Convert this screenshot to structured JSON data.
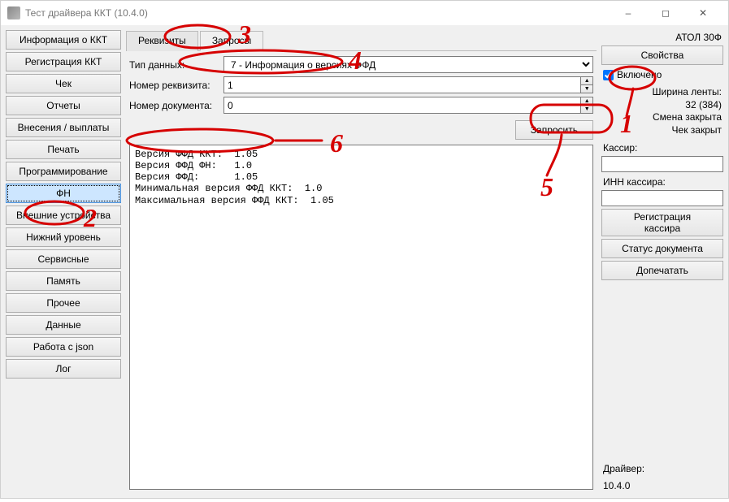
{
  "window": {
    "title": "Тест драйвера ККТ (10.4.0)"
  },
  "nav": {
    "items": [
      "Информация о ККТ",
      "Регистрация ККТ",
      "Чек",
      "Отчеты",
      "Внесения / выплаты",
      "Печать",
      "Программирование",
      "ФН",
      "Внешние устройства",
      "Нижний уровень",
      "Сервисные",
      "Память",
      "Прочее",
      "Данные",
      "Работа с json",
      "Лог"
    ],
    "active_index": 7
  },
  "tabs": {
    "items": [
      "Реквизиты",
      "Запросы"
    ],
    "active_index": 1
  },
  "form": {
    "type_label": "Тип данных:",
    "type_value": "7 - Информация о версиях ФФД",
    "req_label": "Номер реквизита:",
    "req_value": "1",
    "doc_label": "Номер документа:",
    "doc_value": "0",
    "request_btn": "Запросить"
  },
  "log_text": "Версия ФФД ККТ:  1.05\nВерсия ФФД ФН:   1.0\nВерсия ФФД:      1.05\nМинимальная версия ФФД ККТ:  1.0\nМаксимальная версия ФФД ККТ:  1.05",
  "right": {
    "device": "АТОЛ 30Ф",
    "props_btn": "Свойства",
    "enabled_label": "Включено",
    "enabled_checked": true,
    "tape_label": "Ширина ленты:",
    "tape_value": "32 (384)",
    "shift_label": "Смена закрыта",
    "cheque_label": "Чек закрыт",
    "cashier_label": "Кассир:",
    "cashier_value": "",
    "inn_label": "ИНН кассира:",
    "inn_value": "",
    "reg_btn": "Регистрация кассира",
    "status_btn": "Статус документа",
    "print_btn": "Допечатать",
    "driver_label": "Драйвер:",
    "driver_value": "10.4.0"
  },
  "annotations": [
    "1",
    "2",
    "3",
    "4",
    "5",
    "6"
  ]
}
